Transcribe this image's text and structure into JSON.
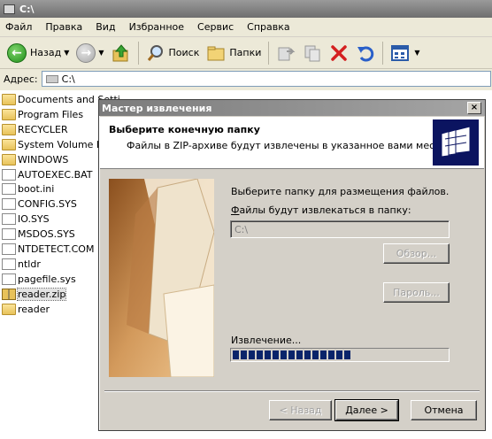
{
  "window": {
    "title": "C:\\"
  },
  "menu": [
    "Файл",
    "Правка",
    "Вид",
    "Избранное",
    "Сервис",
    "Справка"
  ],
  "toolbar": {
    "back_label": "Назад",
    "search_label": "Поиск",
    "folders_label": "Папки"
  },
  "address": {
    "label": "Адрес:",
    "value": "C:\\"
  },
  "files": [
    {
      "name": "Documents and Setti",
      "type": "folder"
    },
    {
      "name": "Program Files",
      "type": "folder"
    },
    {
      "name": "RECYCLER",
      "type": "folder"
    },
    {
      "name": "System Volume Info",
      "type": "folder"
    },
    {
      "name": "WINDOWS",
      "type": "folder"
    },
    {
      "name": "AUTOEXEC.BAT",
      "type": "file"
    },
    {
      "name": "boot.ini",
      "type": "file"
    },
    {
      "name": "CONFIG.SYS",
      "type": "file"
    },
    {
      "name": "IO.SYS",
      "type": "file"
    },
    {
      "name": "MSDOS.SYS",
      "type": "file"
    },
    {
      "name": "NTDETECT.COM",
      "type": "file"
    },
    {
      "name": "ntldr",
      "type": "file"
    },
    {
      "name": "pagefile.sys",
      "type": "file"
    },
    {
      "name": "reader.zip",
      "type": "zip",
      "selected": true
    },
    {
      "name": "reader",
      "type": "folder"
    }
  ],
  "dialog": {
    "title": "Мастер извлечения",
    "close": "×",
    "header_title": "Выберите конечную папку",
    "header_subtitle": "Файлы в ZIP-архиве будут извлечены в указанное вами место.",
    "prompt": "Выберите папку для размещения файлов.",
    "folder_label_accel": "Ф",
    "folder_label_rest": "айлы будут извлекаться в папку:",
    "folder_value": "C:\\",
    "browse_label": "Обзор...",
    "password_label": "Пароль...",
    "extract_label": "Извлечение...",
    "progress": 0.55,
    "back_label": "< Назад",
    "next_label": "Далее >",
    "cancel_label": "Отмена"
  }
}
